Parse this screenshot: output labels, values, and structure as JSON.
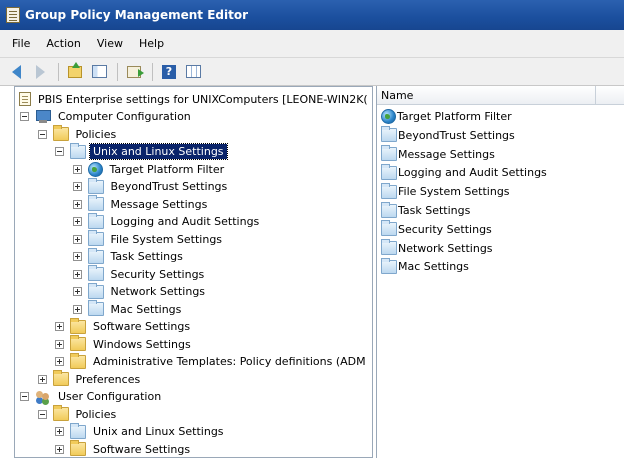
{
  "window": {
    "title": "Group Policy Management Editor"
  },
  "menu": [
    "File",
    "Action",
    "View",
    "Help"
  ],
  "toolbar": [
    {
      "name": "back-button",
      "icon": "back-arrow-icon"
    },
    {
      "name": "forward-button",
      "icon": "forward-arrow-icon"
    },
    {
      "name": "up-one-level-button",
      "icon": "up-folder-icon"
    },
    {
      "name": "show-hide-tree-button",
      "icon": "console-tree-icon"
    },
    {
      "name": "export-list-button",
      "icon": "export-icon"
    },
    {
      "name": "help-button",
      "icon": "help-icon"
    },
    {
      "name": "show-hide-action-pane-button",
      "icon": "action-pane-icon"
    }
  ],
  "tree": [
    {
      "label": "PBIS Enterprise settings for UNIXComputers [LEONE-WIN2K(",
      "icon": "doc",
      "level": 0,
      "expander": "none"
    },
    {
      "label": "Computer Configuration",
      "icon": "computer",
      "level": 0,
      "expander": "minus"
    },
    {
      "label": "Policies",
      "icon": "folder-yellow",
      "level": 1,
      "expander": "minus"
    },
    {
      "label": "Unix and Linux Settings",
      "icon": "folder-blue",
      "level": 2,
      "expander": "minus",
      "selected": true
    },
    {
      "label": "Target Platform Filter",
      "icon": "globe",
      "level": 3,
      "expander": "plus"
    },
    {
      "label": "BeyondTrust Settings",
      "icon": "folder-blue",
      "level": 3,
      "expander": "plus"
    },
    {
      "label": "Message Settings",
      "icon": "folder-blue",
      "level": 3,
      "expander": "plus"
    },
    {
      "label": "Logging and Audit Settings",
      "icon": "folder-blue",
      "level": 3,
      "expander": "plus"
    },
    {
      "label": "File System Settings",
      "icon": "folder-blue",
      "level": 3,
      "expander": "plus"
    },
    {
      "label": "Task Settings",
      "icon": "folder-blue",
      "level": 3,
      "expander": "plus"
    },
    {
      "label": "Security Settings",
      "icon": "folder-blue",
      "level": 3,
      "expander": "plus"
    },
    {
      "label": "Network Settings",
      "icon": "folder-blue",
      "level": 3,
      "expander": "plus"
    },
    {
      "label": "Mac Settings",
      "icon": "folder-blue",
      "level": 3,
      "expander": "plus"
    },
    {
      "label": "Software Settings",
      "icon": "folder-yellow",
      "level": 2,
      "expander": "plus"
    },
    {
      "label": "Windows Settings",
      "icon": "folder-yellow",
      "level": 2,
      "expander": "plus"
    },
    {
      "label": "Administrative Templates: Policy definitions (ADM",
      "icon": "folder-yellow",
      "level": 2,
      "expander": "plus"
    },
    {
      "label": "Preferences",
      "icon": "folder-yellow",
      "level": 1,
      "expander": "plus"
    },
    {
      "label": "User Configuration",
      "icon": "users",
      "level": 0,
      "expander": "minus"
    },
    {
      "label": "Policies",
      "icon": "folder-yellow",
      "level": 1,
      "expander": "minus"
    },
    {
      "label": "Unix and Linux Settings",
      "icon": "folder-blue",
      "level": 2,
      "expander": "plus"
    },
    {
      "label": "Software Settings",
      "icon": "folder-yellow",
      "level": 2,
      "expander": "plus"
    }
  ],
  "list": {
    "columns": [
      "Name",
      ""
    ],
    "items": [
      {
        "label": "Target Platform Filter",
        "icon": "globe"
      },
      {
        "label": "BeyondTrust Settings",
        "icon": "folder-blue"
      },
      {
        "label": "Message Settings",
        "icon": "folder-blue"
      },
      {
        "label": "Logging and Audit Settings",
        "icon": "folder-blue"
      },
      {
        "label": "File System Settings",
        "icon": "folder-blue"
      },
      {
        "label": "Task Settings",
        "icon": "folder-blue"
      },
      {
        "label": "Security Settings",
        "icon": "folder-blue"
      },
      {
        "label": "Network Settings",
        "icon": "folder-blue"
      },
      {
        "label": "Mac Settings",
        "icon": "folder-blue"
      }
    ]
  },
  "colors": {
    "titlebar": "#1b4f9e",
    "selection": "#0a246a",
    "chrome": "#f0f0f0"
  }
}
